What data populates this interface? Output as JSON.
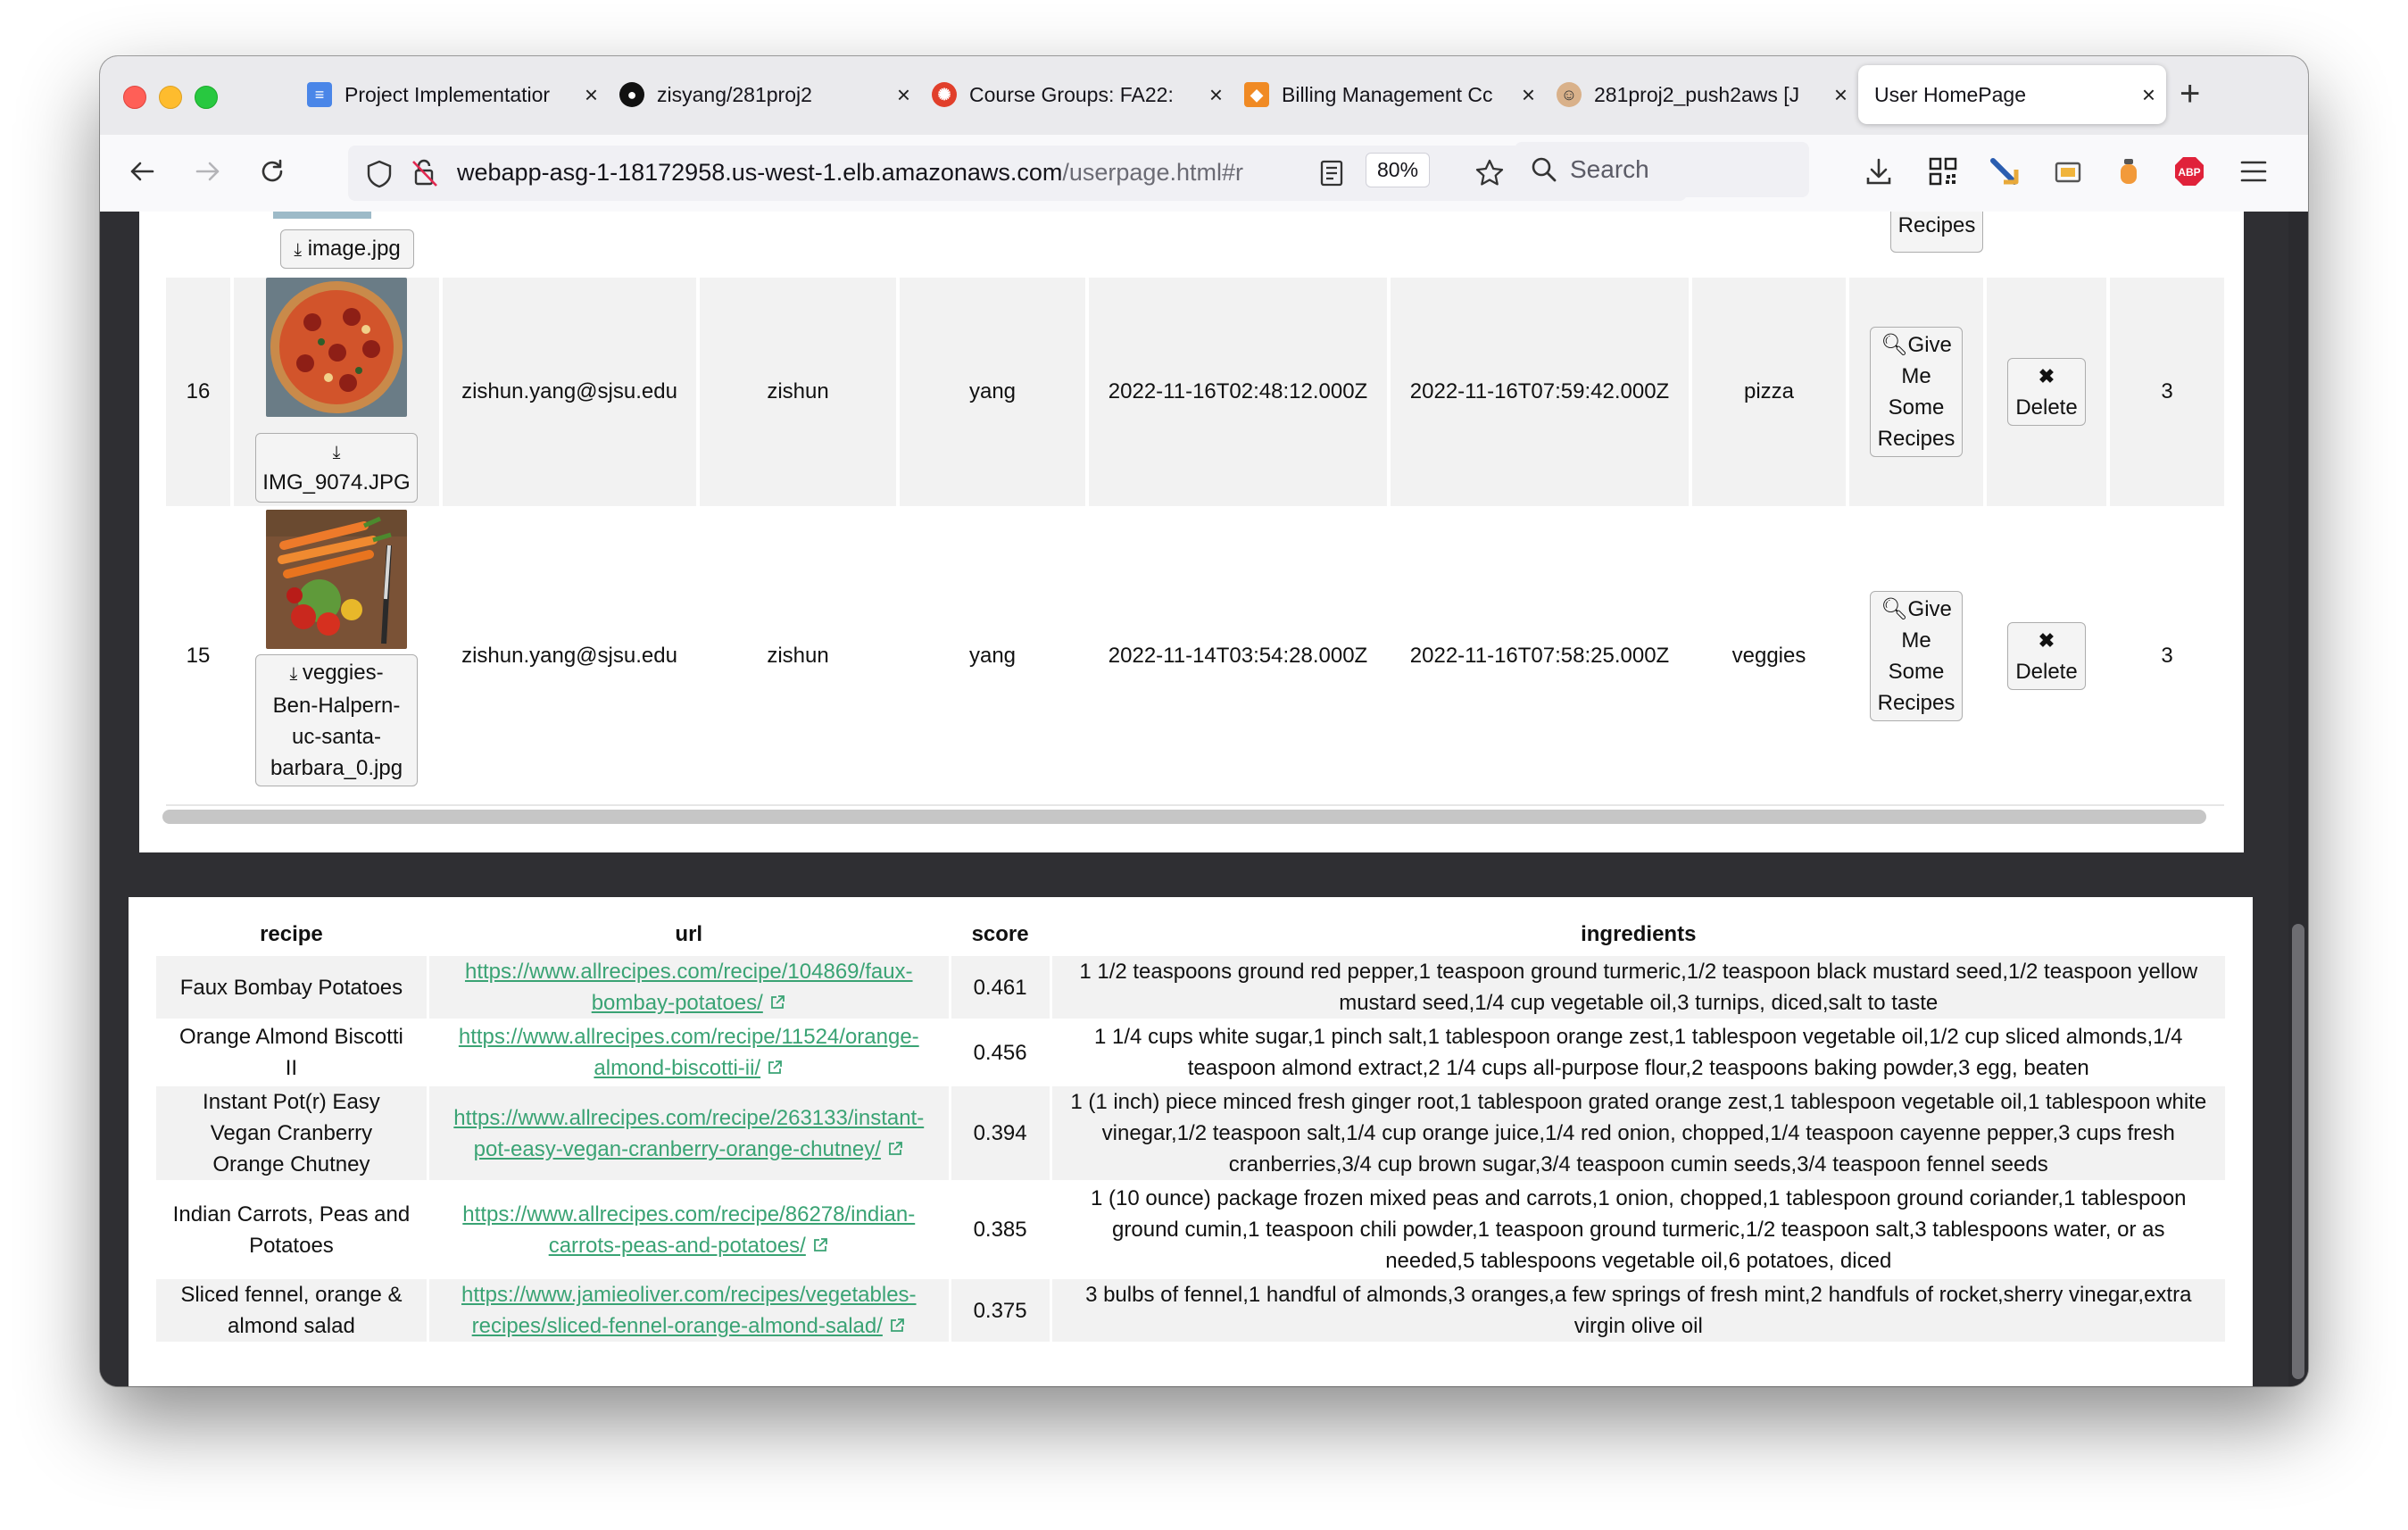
{
  "browser": {
    "tabs": [
      {
        "title": "Project Implementatior",
        "icon": "google-docs-icon"
      },
      {
        "title": "zisyang/281proj2",
        "icon": "github-icon"
      },
      {
        "title": "Course Groups: FA22:",
        "icon": "canvas-icon"
      },
      {
        "title": "Billing Management Cc",
        "icon": "aws-icon"
      },
      {
        "title": "281proj2_push2aws [J",
        "icon": "jenkins-icon"
      },
      {
        "title": "User HomePage",
        "icon": "none",
        "active": true
      }
    ],
    "url_host": "webapp-asg-1-18172958.us-west-1.elb.amazonaws.com",
    "url_path": "/userpage.html#r",
    "zoom": "80%",
    "search_placeholder": "Search"
  },
  "uploads": {
    "partial_row": {
      "filename": "image.jpg",
      "action_tail": "Recipes"
    },
    "rows": [
      {
        "id": "16",
        "filename": "IMG_9074.JPG",
        "email": "zishun.yang@sjsu.edu",
        "first_name": "zishun",
        "last_name": "yang",
        "created": "2022-11-16T02:48:12.000Z",
        "updated": "2022-11-16T07:59:42.000Z",
        "description": "pizza",
        "recipes_button": [
          "Give",
          "Me",
          "Some",
          "Recipes"
        ],
        "delete_button": "Delete",
        "count": "3"
      },
      {
        "id": "15",
        "filename_lines": [
          "veggies-",
          "Ben-Halpern-",
          "uc-santa-",
          "barbara_0.jpg"
        ],
        "email": "zishun.yang@sjsu.edu",
        "first_name": "zishun",
        "last_name": "yang",
        "created": "2022-11-14T03:54:28.000Z",
        "updated": "2022-11-16T07:58:25.000Z",
        "description": "veggies",
        "recipes_button": [
          "Give",
          "Me",
          "Some",
          "Recipes"
        ],
        "delete_button": "Delete",
        "count": "3"
      }
    ]
  },
  "recipes": {
    "headers": {
      "recipe": "recipe",
      "url": "url",
      "score": "score",
      "ingredients": "ingredients"
    },
    "rows": [
      {
        "recipe": [
          "Faux Bombay Potatoes"
        ],
        "url": [
          "https://www.allrecipes.com/recipe/104869/faux-",
          "bombay-potatoes/"
        ],
        "score": "0.461",
        "ingredients": [
          "1 1/2 teaspoons ground red pepper,1 teaspoon ground turmeric,1/2 teaspoon black mustard seed,1/2 teaspoon yellow",
          "mustard seed,1/4 cup vegetable oil,3 turnips, diced,salt to taste"
        ]
      },
      {
        "recipe": [
          "Orange Almond Biscotti",
          "II"
        ],
        "url": [
          "https://www.allrecipes.com/recipe/11524/orange-",
          "almond-biscotti-ii/"
        ],
        "score": "0.456",
        "ingredients": [
          "1 1/4 cups white sugar,1 pinch salt,1 tablespoon orange zest,1 tablespoon vegetable oil,1/2 cup sliced almonds,1/4",
          "teaspoon almond extract,2 1/4 cups all-purpose flour,2 teaspoons baking powder,3 egg, beaten"
        ]
      },
      {
        "recipe": [
          "Instant Pot(r) Easy",
          "Vegan Cranberry",
          "Orange Chutney"
        ],
        "url": [
          "https://www.allrecipes.com/recipe/263133/instant-",
          "pot-easy-vegan-cranberry-orange-chutney/"
        ],
        "score": "0.394",
        "ingredients": [
          "1 (1 inch) piece minced fresh ginger root,1 tablespoon grated orange zest,1 tablespoon vegetable oil,1 tablespoon white",
          "vinegar,1/2 teaspoon salt,1/4 cup orange juice,1/4 red onion, chopped,1/4 teaspoon cayenne pepper,3 cups fresh",
          "cranberries,3/4 cup brown sugar,3/4 teaspoon cumin seeds,3/4 teaspoon fennel seeds"
        ]
      },
      {
        "recipe": [
          "Indian Carrots, Peas and",
          "Potatoes"
        ],
        "url": [
          "https://www.allrecipes.com/recipe/86278/indian-",
          "carrots-peas-and-potatoes/"
        ],
        "score": "0.385",
        "ingredients": [
          "1 (10 ounce) package frozen mixed peas and carrots,1 onion, chopped,1 tablespoon ground coriander,1 tablespoon",
          "ground cumin,1 teaspoon chili powder,1 teaspoon ground turmeric,1/2 teaspoon salt,3 tablespoons water, or as",
          "needed,5 tablespoons vegetable oil,6 potatoes, diced"
        ]
      },
      {
        "recipe": [
          "Sliced fennel, orange &",
          "almond salad"
        ],
        "url": [
          "https://www.jamieoliver.com/recipes/vegetables-",
          "recipes/sliced-fennel-orange-almond-salad/"
        ],
        "score": "0.375",
        "ingredients": [
          "3 bulbs of fennel,1 handful of almonds,3 oranges,a few springs of fresh mint,2 handfuls of rocket,sherry vinegar,extra",
          "virgin olive oil"
        ]
      }
    ]
  }
}
